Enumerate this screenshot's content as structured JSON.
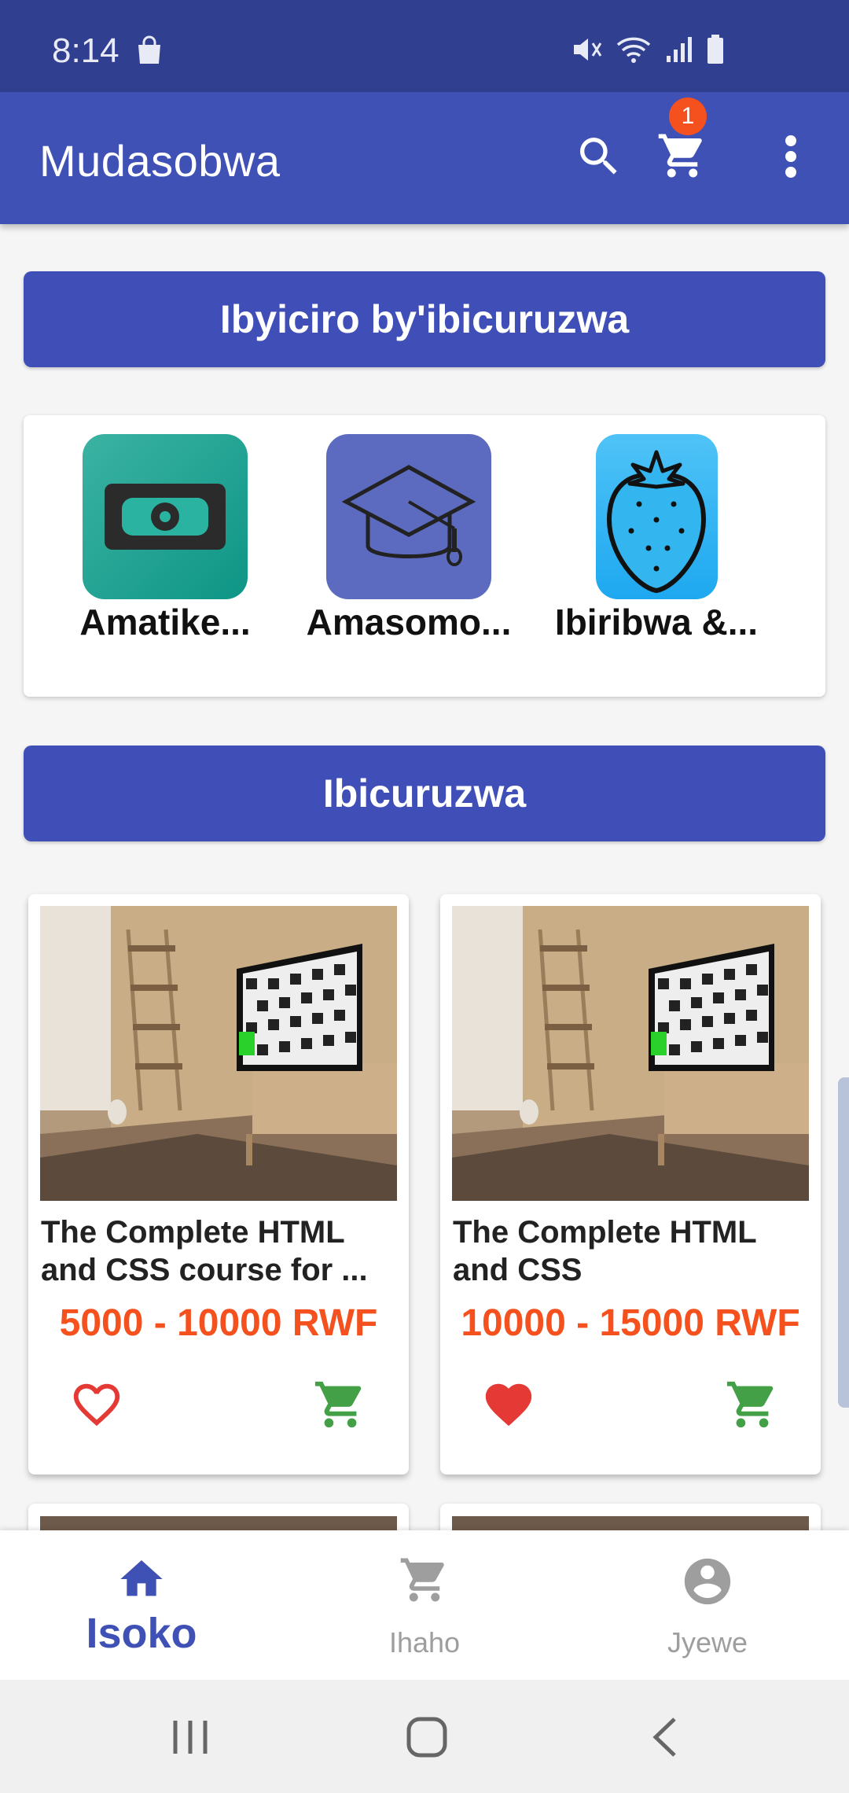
{
  "status_bar": {
    "time": "8:14"
  },
  "app_bar": {
    "title": "Mudasobwa",
    "cart_badge": "1"
  },
  "sections": {
    "categories_title": "Ibyiciro by'ibicuruzwa",
    "products_title": "Ibicuruzwa"
  },
  "categories": [
    {
      "label": "Amatike...",
      "icon": "ticket-icon",
      "color": "#26a69a"
    },
    {
      "label": "Amasomo...",
      "icon": "graduation-cap-icon",
      "color": "#5c6bc0"
    },
    {
      "label": "Ibiribwa &...",
      "icon": "strawberry-icon",
      "color": "#29b6f6"
    }
  ],
  "products": [
    {
      "title": "The Complete HTML and CSS course for ...",
      "price": "5000 - 10000 RWF",
      "favorited": false
    },
    {
      "title": "The Complete HTML and CSS",
      "price": "10000 - 15000 RWF",
      "favorited": true
    }
  ],
  "bottom_nav": {
    "home": "Isoko",
    "cart": "Ihaho",
    "profile": "Jyewe"
  },
  "colors": {
    "primary": "#3f51b5",
    "status_bar": "#303f8f",
    "price": "#f4511e",
    "cart_green": "#43a047",
    "favorite_red": "#e53935"
  }
}
